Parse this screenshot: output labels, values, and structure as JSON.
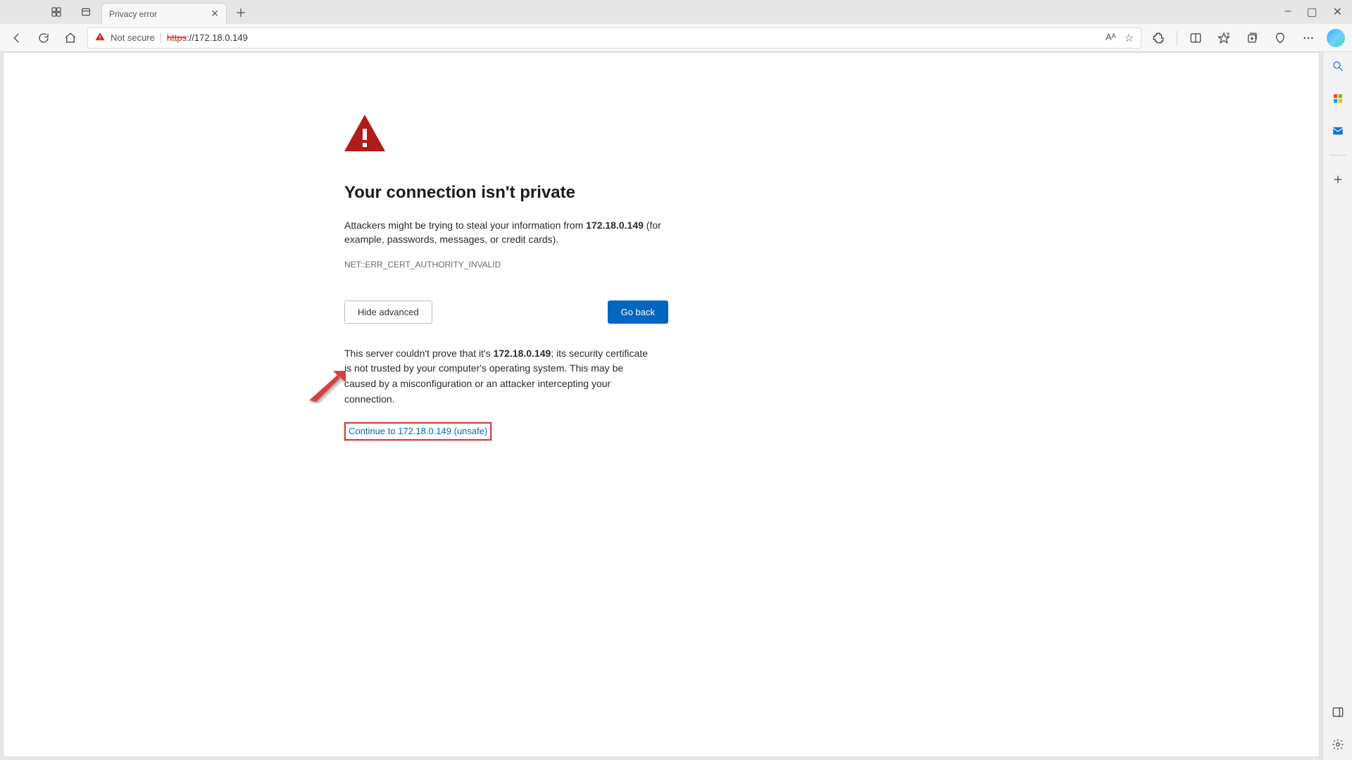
{
  "tab": {
    "title": "Privacy error"
  },
  "window": {
    "minimize": "–",
    "maximize": "▢",
    "close": "✕"
  },
  "address": {
    "not_secure_label": "Not secure",
    "scheme": "https",
    "rest": "://172.18.0.149"
  },
  "toolbar_icons": {
    "read_aloud": "Aᴬ",
    "favorite": "☆"
  },
  "page": {
    "heading": "Your connection isn't private",
    "warn_pre": "Attackers might be trying to steal your information from ",
    "warn_ip": "172.18.0.149",
    "warn_post": " (for example, passwords, messages, or credit cards).",
    "error_code": "NET::ERR_CERT_AUTHORITY_INVALID",
    "hide_advanced": "Hide advanced",
    "go_back": "Go back",
    "adv_pre": "This server couldn't prove that it's ",
    "adv_ip": "172.18.0.149",
    "adv_post": "; its security certificate is not trusted by your computer's operating system. This may be caused by a misconfiguration or an attacker intercepting your connection.",
    "proceed": "Continue to 172.18.0.149 (unsafe)"
  }
}
